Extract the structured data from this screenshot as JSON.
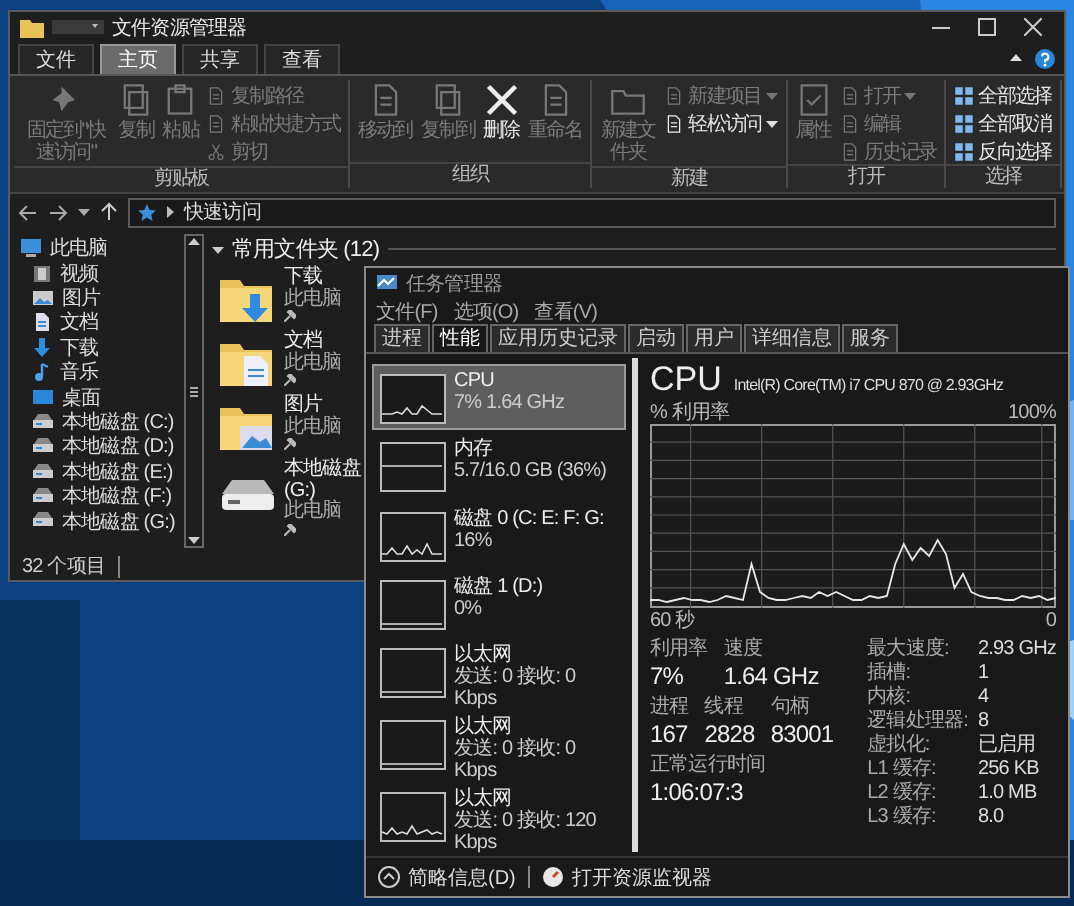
{
  "explorer": {
    "title": "文件资源管理器",
    "tabs": [
      {
        "label": "文件",
        "selected": false
      },
      {
        "label": "主页",
        "selected": true
      },
      {
        "label": "共享",
        "selected": false
      },
      {
        "label": "查看",
        "selected": false
      }
    ],
    "ribbon_groups": [
      {
        "label": "剪贴板",
        "buttons": [
          {
            "label": "固定到\"快速访问\"",
            "kind": "large",
            "disabled": true
          },
          {
            "label": "复制",
            "kind": "large",
            "disabled": true
          },
          {
            "label": "粘贴",
            "kind": "large",
            "disabled": true
          },
          {
            "label": "复制路径",
            "kind": "small",
            "disabled": true
          },
          {
            "label": "粘贴快捷方式",
            "kind": "small",
            "disabled": true
          },
          {
            "label": "剪切",
            "kind": "small",
            "disabled": true
          }
        ]
      },
      {
        "label": "组织",
        "buttons": [
          {
            "label": "移动到",
            "kind": "large",
            "disabled": true
          },
          {
            "label": "复制到",
            "kind": "large",
            "disabled": true
          },
          {
            "label": "删除",
            "kind": "large",
            "disabled": false
          },
          {
            "label": "重命名",
            "kind": "large",
            "disabled": true
          }
        ]
      },
      {
        "label": "新建",
        "buttons": [
          {
            "label": "新建文件夹",
            "kind": "large",
            "disabled": true
          },
          {
            "label": "新建项目",
            "kind": "small",
            "disabled": true,
            "dropdown": true
          },
          {
            "label": "轻松访问",
            "kind": "small",
            "disabled": false,
            "dropdown": true
          }
        ]
      },
      {
        "label": "打开",
        "buttons": [
          {
            "label": "属性",
            "kind": "large",
            "disabled": true
          },
          {
            "label": "打开",
            "kind": "small",
            "disabled": true,
            "dropdown": true
          },
          {
            "label": "编辑",
            "kind": "small",
            "disabled": true
          },
          {
            "label": "历史记录",
            "kind": "small",
            "disabled": true
          }
        ]
      },
      {
        "label": "选择",
        "buttons": [
          {
            "label": "全部选择",
            "kind": "small",
            "disabled": false
          },
          {
            "label": "全部取消",
            "kind": "small",
            "disabled": false
          },
          {
            "label": "反向选择",
            "kind": "small",
            "disabled": false
          }
        ]
      }
    ],
    "address": "快速访问",
    "sidebar": [
      {
        "label": "此电脑",
        "kind": "pc"
      },
      {
        "label": "视频",
        "kind": "video"
      },
      {
        "label": "图片",
        "kind": "picture"
      },
      {
        "label": "文档",
        "kind": "doc"
      },
      {
        "label": "下载",
        "kind": "download"
      },
      {
        "label": "音乐",
        "kind": "music"
      },
      {
        "label": "桌面",
        "kind": "desktop"
      },
      {
        "label": "本地磁盘 (C:)",
        "kind": "drive"
      },
      {
        "label": "本地磁盘 (D:)",
        "kind": "drive"
      },
      {
        "label": "本地磁盘 (E:)",
        "kind": "drive"
      },
      {
        "label": "本地磁盘 (F:)",
        "kind": "drive"
      },
      {
        "label": "本地磁盘 (G:)",
        "kind": "drive"
      }
    ],
    "section": {
      "title": "常用文件夹 (12)",
      "expanded": true
    },
    "folders": [
      {
        "name": "下载",
        "location": "此电脑",
        "kind": "download"
      },
      {
        "name": "文档",
        "location": "此电脑",
        "kind": "doc"
      },
      {
        "name": "图片",
        "location": "此电脑",
        "kind": "picture"
      },
      {
        "name": "本地磁盘 (G:)",
        "location": "此电脑",
        "kind": "drive"
      }
    ],
    "status": "32 个项目"
  },
  "task_manager": {
    "title": "任务管理器",
    "menu": [
      "文件(F)",
      "选项(O)",
      "查看(V)"
    ],
    "tabs": [
      {
        "label": "进程",
        "selected": false
      },
      {
        "label": "性能",
        "selected": true
      },
      {
        "label": "应用历史记录",
        "selected": false
      },
      {
        "label": "启动",
        "selected": false
      },
      {
        "label": "用户",
        "selected": false
      },
      {
        "label": "详细信息",
        "selected": false
      },
      {
        "label": "服务",
        "selected": false
      }
    ],
    "resources": [
      {
        "name": "CPU",
        "detail": "7% 1.64 GHz",
        "selected": true
      },
      {
        "name": "内存",
        "detail": "5.7/16.0 GB (36%)",
        "selected": false
      },
      {
        "name": "磁盘 0 (C: E: F: G:",
        "detail": "16%",
        "selected": false
      },
      {
        "name": "磁盘 1 (D:)",
        "detail": "0%",
        "selected": false
      },
      {
        "name": "以太网",
        "detail": "发送: 0 接收: 0 Kbps",
        "selected": false
      },
      {
        "name": "以太网",
        "detail": "发送: 0 接收: 0 Kbps",
        "selected": false
      },
      {
        "name": "以太网",
        "detail": "发送: 0 接收: 120 Kbps",
        "selected": false
      }
    ],
    "cpu": {
      "title": "CPU",
      "model": "Intel(R) Core(TM) i7 CPU 870 @ 2.93GHz",
      "graph_label": "% 利用率",
      "graph_max": "100%",
      "graph_span": "60 秒",
      "graph_min": "0",
      "stats": [
        {
          "label": "利用率",
          "value": "7%"
        },
        {
          "label": "速度",
          "value": "1.64 GHz"
        }
      ],
      "counts": [
        {
          "label": "进程",
          "value": "167"
        },
        {
          "label": "线程",
          "value": "2828"
        },
        {
          "label": "句柄",
          "value": "83001"
        }
      ],
      "uptime": {
        "label": "正常运行时间",
        "value": "1:06:07:3"
      },
      "details": [
        {
          "label": "最大速度:",
          "value": "2.93 GHz"
        },
        {
          "label": "插槽:",
          "value": "1"
        },
        {
          "label": "内核:",
          "value": "4"
        },
        {
          "label": "逻辑处理器:",
          "value": "8"
        },
        {
          "label": "虚拟化:",
          "value": "已启用"
        },
        {
          "label": "L1 缓存:",
          "value": "256 KB"
        },
        {
          "label": "L2 缓存:",
          "value": "1.0 MB"
        },
        {
          "label": "L3 缓存:",
          "value": "8.0"
        }
      ]
    },
    "footer": {
      "fewer_details": "简略信息(D)",
      "open_monitor": "打开资源监视器"
    }
  }
}
